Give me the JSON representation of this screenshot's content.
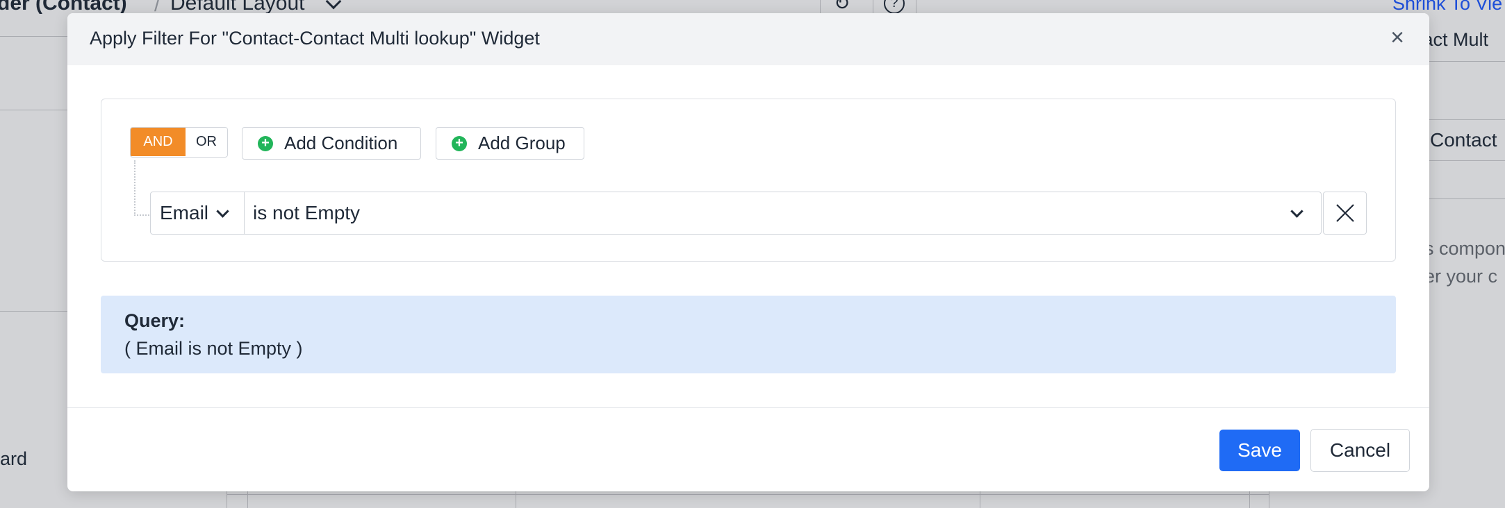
{
  "background": {
    "page_title": "der (Contact)",
    "separator": "/",
    "layout_selector": "Default Layout",
    "shrink_link": "Shrink To Vie",
    "right_field_fragment": "tact Mult",
    "right_contact_fragment": "Contact",
    "right_text_line1": "s compon",
    "right_text_line2": "er your c",
    "left_text_fragment": "ard"
  },
  "modal": {
    "title": "Apply Filter For \"Contact-Contact Multi lookup\" Widget",
    "close_symbol": "×",
    "logic": {
      "and_label": "AND",
      "or_label": "OR",
      "active": "AND"
    },
    "add_condition_label": "Add Condition",
    "add_group_label": "Add Group",
    "plus_symbol": "+",
    "condition": {
      "field": "Email",
      "operator": "is not Empty"
    },
    "query": {
      "label": "Query:",
      "text": "( Email is not Empty )"
    },
    "save_label": "Save",
    "cancel_label": "Cancel"
  },
  "colors": {
    "and_active": "#f28c28",
    "save_button": "#1f6bf5",
    "plus_icon": "#22b55a",
    "query_background": "#dce9fb",
    "link": "#1d4ed8"
  },
  "icons": [
    "close-icon",
    "chevron-down-icon",
    "plus-circle-icon",
    "refresh-icon",
    "help-icon"
  ]
}
